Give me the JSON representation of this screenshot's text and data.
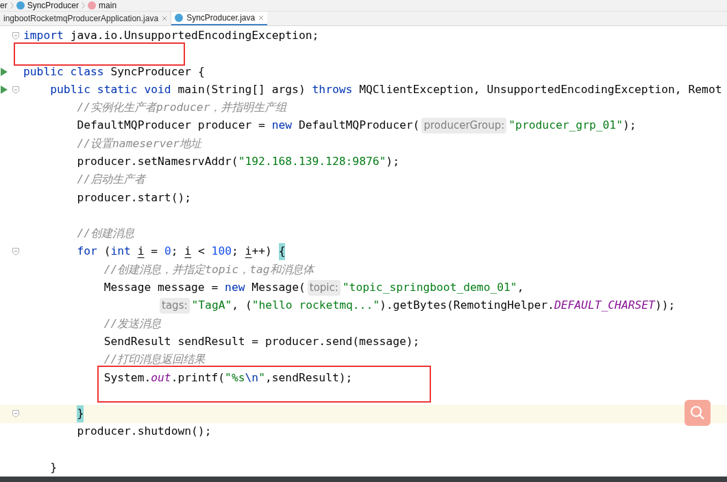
{
  "breadcrumb": [
    {
      "label": "er",
      "kind": "text"
    },
    {
      "label": "SyncProducer",
      "kind": "class"
    },
    {
      "label": "main",
      "kind": "method"
    }
  ],
  "tabs": [
    {
      "label": "ingbootRocketmqProducerApplication.java",
      "selected": false
    },
    {
      "label": "SyncProducer.java",
      "selected": true
    }
  ],
  "lines": [
    {
      "kind": "fold",
      "boxed": false,
      "current": false,
      "tokens": [
        {
          "kind": "kw",
          "text": "import"
        },
        {
          "kind": "plain",
          "text": " java.io.UnsupportedEncodingException;"
        }
      ]
    },
    {
      "kind": "plain",
      "boxed": true,
      "current": false
    },
    {
      "kind": "run",
      "boxed": false,
      "current": false,
      "tokens": [
        {
          "kind": "kw",
          "text": "public class"
        },
        {
          "kind": "plain",
          "text": " SyncProducer {"
        }
      ]
    },
    {
      "kind": "run_fold",
      "boxed": false,
      "current": false,
      "tokens": [
        {
          "kind": "kw",
          "text": "    public static void"
        },
        {
          "kind": "plain",
          "text": " main(String[] args) "
        },
        {
          "kind": "kw",
          "text": "throws"
        },
        {
          "kind": "plain",
          "text": " MQClientException, UnsupportedEncodingException, Remot"
        }
      ]
    },
    {
      "kind": "plain",
      "boxed": false,
      "current": false,
      "tokens": [
        {
          "kind": "comment",
          "text": "        //实例化生产者producer，并指明生产组"
        }
      ]
    },
    {
      "kind": "plain",
      "boxed": false,
      "current": false,
      "tokens": [
        {
          "kind": "plain",
          "text": "        DefaultMQProducer producer = "
        },
        {
          "kind": "kw",
          "text": "new"
        },
        {
          "kind": "plain",
          "text": " DefaultMQProducer("
        },
        {
          "kind": "hint",
          "text": "producerGroup:"
        },
        {
          "kind": "str",
          "text": "\"producer_grp_01\""
        },
        {
          "kind": "plain",
          "text": ");"
        }
      ]
    },
    {
      "kind": "plain",
      "boxed": false,
      "current": false,
      "tokens": [
        {
          "kind": "comment",
          "text": "        //设置nameserver地址"
        }
      ]
    },
    {
      "kind": "plain",
      "boxed": false,
      "current": false,
      "tokens": [
        {
          "kind": "plain",
          "text": "        producer.setNamesrvAddr("
        },
        {
          "kind": "str",
          "text": "\"192.168.139.128:9876\""
        },
        {
          "kind": "plain",
          "text": ");"
        }
      ]
    },
    {
      "kind": "plain",
      "boxed": false,
      "current": false,
      "tokens": [
        {
          "kind": "comment",
          "text": "        //启动生产者"
        }
      ]
    },
    {
      "kind": "plain",
      "boxed": false,
      "current": false,
      "tokens": [
        {
          "kind": "plain",
          "text": "        producer.start();"
        }
      ]
    },
    {
      "kind": "plain",
      "boxed": false,
      "current": false
    },
    {
      "kind": "plain",
      "boxed": false,
      "current": false,
      "tokens": [
        {
          "kind": "comment",
          "text": "        //创建消息"
        }
      ]
    },
    {
      "kind": "fold",
      "boxed": false,
      "current": false,
      "tokens": [
        {
          "kind": "kw",
          "text": "        for"
        },
        {
          "kind": "plain",
          "text": " ("
        },
        {
          "kind": "kw",
          "text": "int "
        },
        {
          "kind": "var",
          "text": "i"
        },
        {
          "kind": "plain",
          "text": " = "
        },
        {
          "kind": "num",
          "text": "0"
        },
        {
          "kind": "plain",
          "text": "; "
        },
        {
          "kind": "var",
          "text": "i"
        },
        {
          "kind": "plain",
          "text": " < "
        },
        {
          "kind": "num",
          "text": "100"
        },
        {
          "kind": "plain",
          "text": "; "
        },
        {
          "kind": "var",
          "text": "i"
        },
        {
          "kind": "plain",
          "text": "++) "
        },
        {
          "kind": "match",
          "text": "{"
        }
      ]
    },
    {
      "kind": "plain",
      "boxed": false,
      "current": false,
      "tokens": [
        {
          "kind": "comment",
          "text": "            //创建消息，并指定topic，tag和消息体"
        }
      ]
    },
    {
      "kind": "plain",
      "boxed": false,
      "current": false,
      "tokens": [
        {
          "kind": "plain",
          "text": "            Message message = "
        },
        {
          "kind": "kw",
          "text": "new"
        },
        {
          "kind": "plain",
          "text": " Message("
        },
        {
          "kind": "hint",
          "text": "topic:"
        },
        {
          "kind": "str",
          "text": "\"topic_springboot_demo_01\""
        },
        {
          "kind": "plain",
          "text": ","
        }
      ]
    },
    {
      "kind": "plain",
      "boxed": false,
      "current": false,
      "tokens": [
        {
          "kind": "hint",
          "text": "                    tags:"
        },
        {
          "kind": "str",
          "text": "\"TagA\""
        },
        {
          "kind": "plain",
          "text": ", ("
        },
        {
          "kind": "str",
          "text": "\"hello rocketmq...\""
        },
        {
          "kind": "plain",
          "text": ").getBytes(RemotingHelper."
        },
        {
          "kind": "field",
          "text": "DEFAULT_CHARSET"
        },
        {
          "kind": "plain",
          "text": "));"
        }
      ]
    },
    {
      "kind": "plain",
      "boxed": false,
      "current": false,
      "tokens": [
        {
          "kind": "comment",
          "text": "            //发送消息"
        }
      ]
    },
    {
      "kind": "plain",
      "boxed": false,
      "current": false,
      "tokens": [
        {
          "kind": "plain",
          "text": "            SendResult sendResult = producer.send(message);"
        }
      ]
    },
    {
      "kind": "plain",
      "boxed": false,
      "current": false,
      "tokens": [
        {
          "kind": "comment",
          "text": "            //打印消息返回结果"
        }
      ]
    },
    {
      "kind": "plain",
      "boxed": true,
      "current": false,
      "tokens": [
        {
          "kind": "plain",
          "text": "            System."
        },
        {
          "kind": "field",
          "text": "out"
        },
        {
          "kind": "plain",
          "text": ".printf("
        },
        {
          "kind": "str",
          "text": "\"%s"
        },
        {
          "kind": "esc",
          "text": "\\n"
        },
        {
          "kind": "str",
          "text": "\""
        },
        {
          "kind": "plain",
          "text": ",sendResult);"
        }
      ]
    },
    {
      "kind": "plain",
      "boxed": false,
      "current": false
    },
    {
      "kind": "fold",
      "boxed": false,
      "current": true,
      "tokens": [
        {
          "kind": "match",
          "text": "        }"
        }
      ]
    },
    {
      "kind": "plain",
      "boxed": false,
      "current": false,
      "tokens": [
        {
          "kind": "plain",
          "text": "        producer.shutdown();"
        }
      ]
    },
    {
      "kind": "plain",
      "boxed": false,
      "current": false
    },
    {
      "kind": "plain",
      "boxed": false,
      "current": false,
      "tokens": [
        {
          "kind": "plain",
          "text": "    }"
        }
      ]
    }
  ]
}
